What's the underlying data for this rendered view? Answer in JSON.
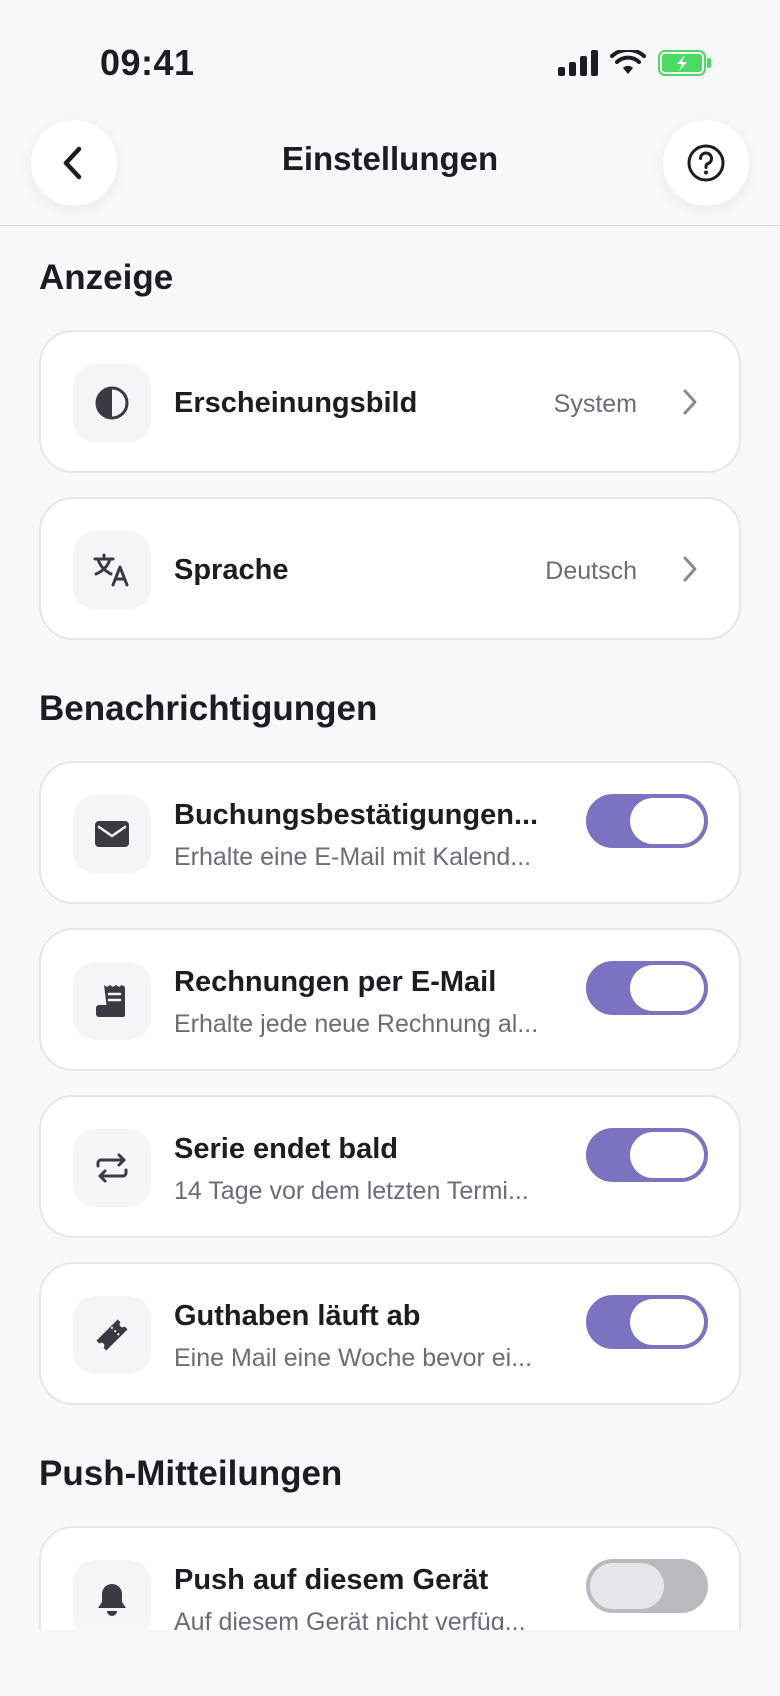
{
  "status_bar": {
    "time": "09:41"
  },
  "header": {
    "title": "Einstellungen"
  },
  "sections": {
    "display": {
      "title": "Anzeige",
      "appearance": {
        "label": "Erscheinungsbild",
        "value": "System"
      },
      "language": {
        "label": "Sprache",
        "value": "Deutsch"
      }
    },
    "notifications": {
      "title": "Benachrichtigungen",
      "items": [
        {
          "label": "Buchungsbestätigungen...",
          "sub": "Erhalte eine E-Mail mit Kalend...",
          "on": true
        },
        {
          "label": "Rechnungen per E-Mail",
          "sub": "Erhalte jede neue Rechnung al...",
          "on": true
        },
        {
          "label": "Serie endet bald",
          "sub": "14 Tage vor dem letzten Termi...",
          "on": true
        },
        {
          "label": "Guthaben läuft ab",
          "sub": "Eine Mail eine Woche bevor ei...",
          "on": true
        }
      ]
    },
    "push": {
      "title": "Push-Mitteilungen",
      "items": [
        {
          "label": "Push auf diesem Gerät",
          "sub": "Auf diesem Gerät nicht verfüg...",
          "on": false
        }
      ]
    }
  },
  "colors": {
    "accent": "#7b72c2",
    "battery": "#4cd964",
    "background": "#f8f8fa"
  }
}
